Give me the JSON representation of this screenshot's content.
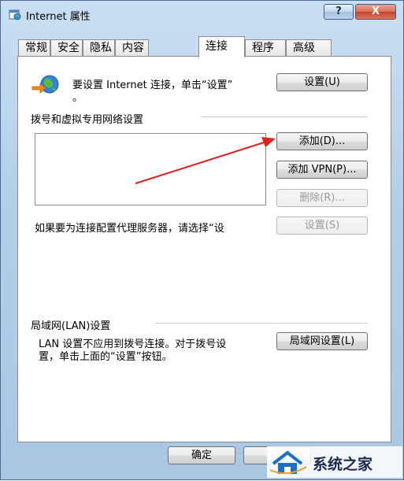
{
  "window": {
    "title": "Internet 属性",
    "help_label": "?",
    "close_label": "X"
  },
  "tabs": [
    {
      "label": "常规"
    },
    {
      "label": "安全"
    },
    {
      "label": "隐私"
    },
    {
      "label": "内容"
    },
    {
      "label": "连接"
    },
    {
      "label": "程序"
    },
    {
      "label": "高级"
    }
  ],
  "setup": {
    "text_line1": "要设置 Internet 连接，单击“设置”",
    "text_line2": "。",
    "button_label": "设置(U)"
  },
  "dialup": {
    "heading": "拨号和虚拟专用网络设置",
    "add_button": "添加(D)...",
    "add_vpn_button": "添加 VPN(P)...",
    "remove_button": "删除(R)...",
    "settings_button": "设置(S)",
    "proxy_text": "如果要为连接配置代理服务器，请选择“设"
  },
  "lan": {
    "heading": "局域网(LAN)设置",
    "text_line1": "LAN 设置不应用到拨号连接。对于拨号设",
    "text_line2": "置，单击上面的“设置”按钮。",
    "button_label": "局域网设置(L)"
  },
  "footer": {
    "ok_button": "确定"
  },
  "watermark": {
    "text": "系统之家"
  },
  "colors": {
    "arrow": "#e02020",
    "title_bar": "#b5cfe8",
    "close_button": "#c4422a"
  }
}
